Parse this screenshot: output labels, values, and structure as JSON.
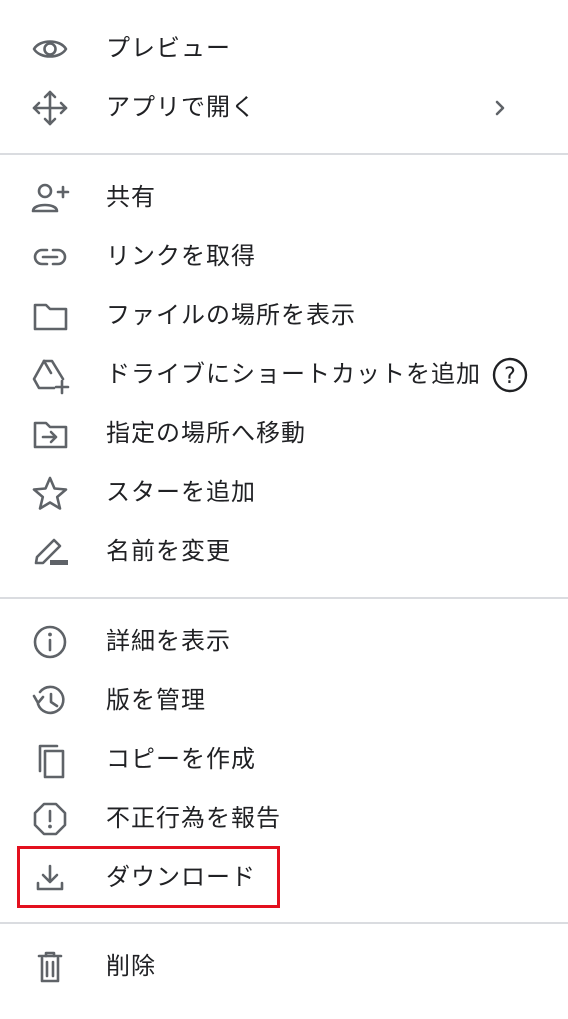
{
  "menu": {
    "items": {
      "preview": {
        "label": "プレビュー",
        "icon": "eye-icon"
      },
      "open_with": {
        "label": "アプリで開く",
        "icon": "move-arrows-icon",
        "chevron": "›"
      },
      "share": {
        "label": "共有",
        "icon": "add-person-icon"
      },
      "get_link": {
        "label": "リンクを取得",
        "icon": "link-icon"
      },
      "show_location": {
        "label": "ファイルの場所を表示",
        "icon": "folder-icon"
      },
      "add_shortcut": {
        "label": "ドライブにショートカットを追加",
        "icon": "add-to-drive-icon",
        "help": "?"
      },
      "move_to": {
        "label": "指定の場所へ移動",
        "icon": "move-to-folder-icon"
      },
      "add_star": {
        "label": "スターを追加",
        "icon": "star-icon"
      },
      "rename": {
        "label": "名前を変更",
        "icon": "pencil-icon"
      },
      "details": {
        "label": "詳細を表示",
        "icon": "info-icon"
      },
      "versions": {
        "label": "版を管理",
        "icon": "history-icon"
      },
      "copy": {
        "label": "コピーを作成",
        "icon": "copy-icon"
      },
      "report": {
        "label": "不正行為を報告",
        "icon": "report-icon"
      },
      "download": {
        "label": "ダウンロード",
        "icon": "download-icon",
        "highlighted": true
      },
      "delete": {
        "label": "削除",
        "icon": "trash-icon"
      }
    }
  },
  "colors": {
    "icon": "#5f6368",
    "text": "#202124",
    "divider": "#dadce0",
    "highlight": "#e3101e"
  }
}
